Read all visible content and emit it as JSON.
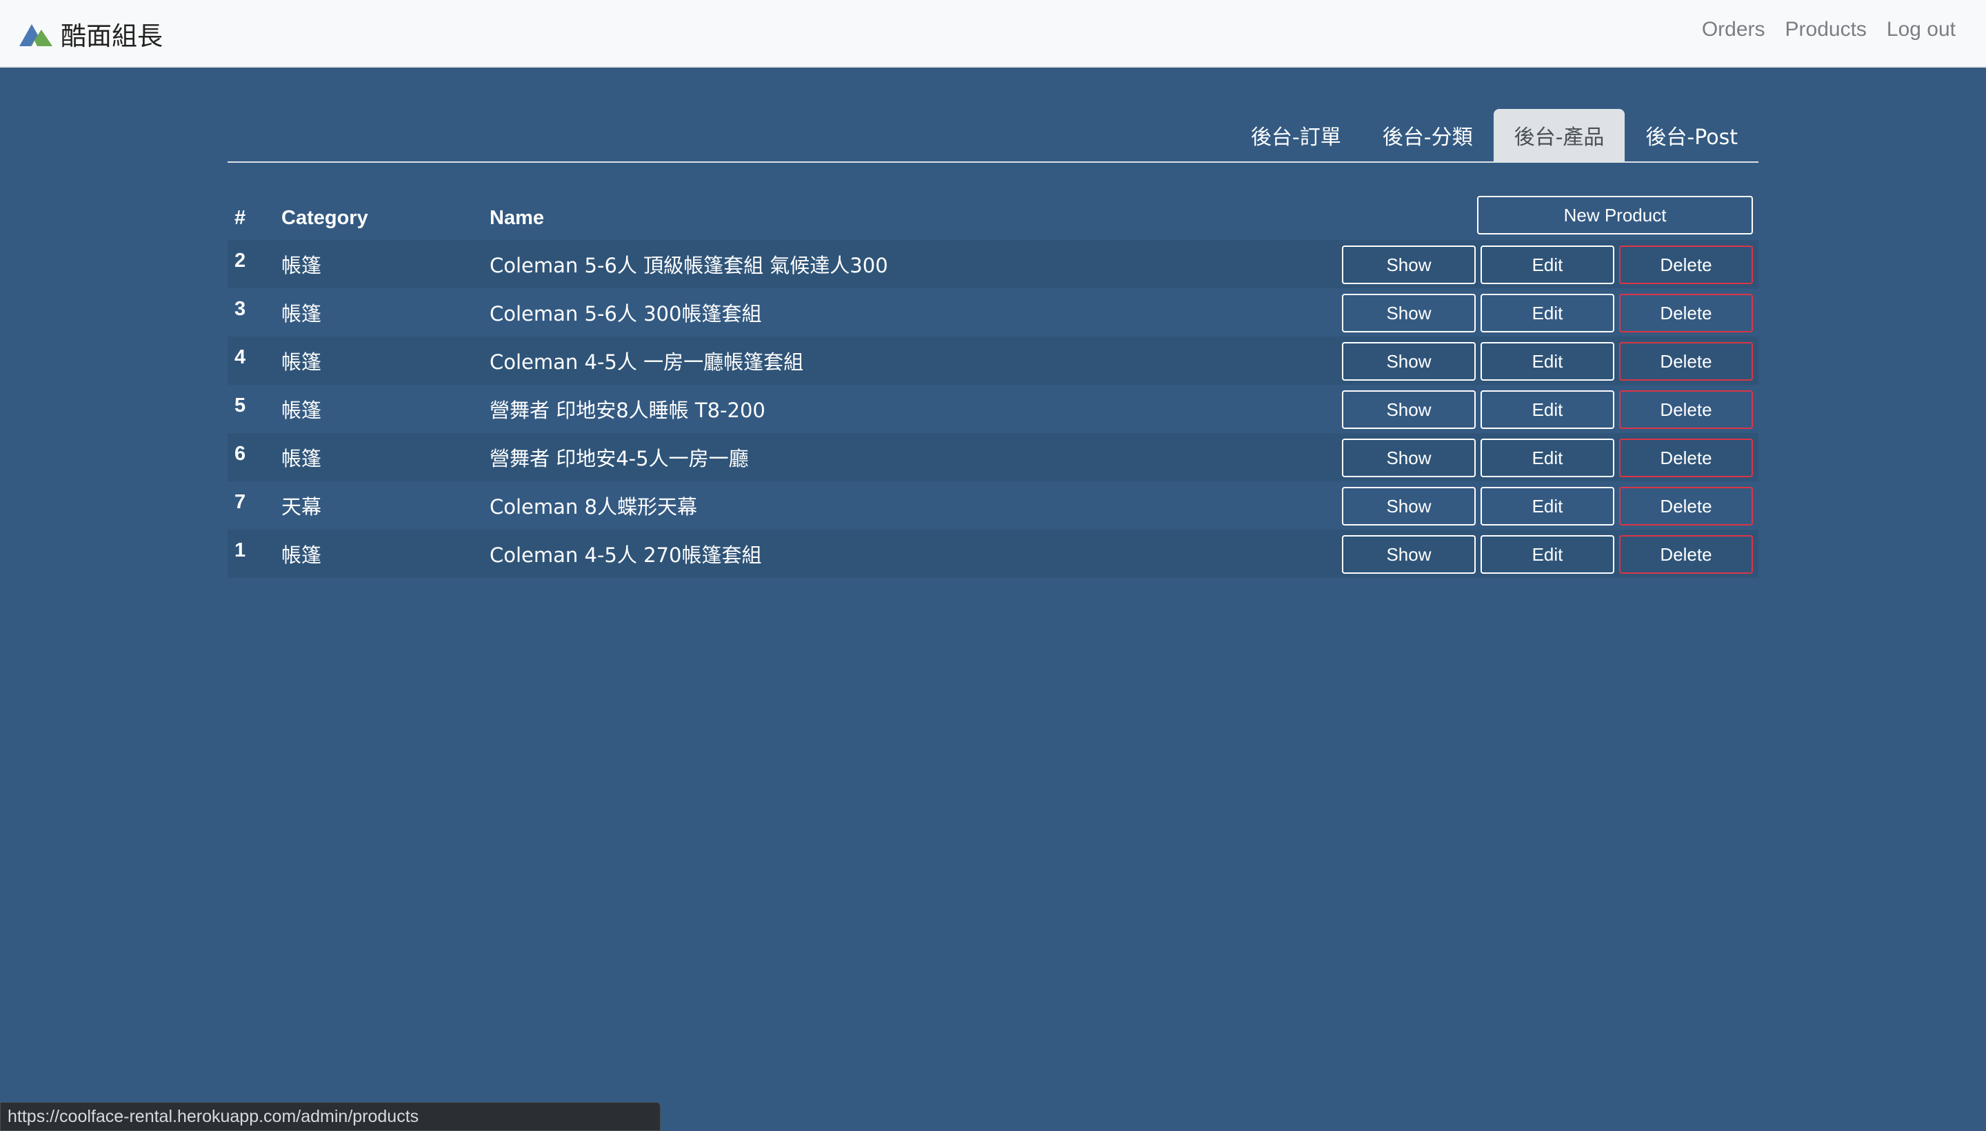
{
  "brand": {
    "name": "酷面組長"
  },
  "nav": {
    "links": [
      "Orders",
      "Products",
      "Log out"
    ]
  },
  "tabs": [
    {
      "label": "後台-訂單",
      "active": false
    },
    {
      "label": "後台-分類",
      "active": false
    },
    {
      "label": "後台-產品",
      "active": true
    },
    {
      "label": "後台-Post",
      "active": false
    }
  ],
  "table": {
    "headers": {
      "num": "#",
      "category": "Category",
      "name": "Name"
    },
    "new_button": "New Product",
    "rows": [
      {
        "id": "2",
        "category": "帳篷",
        "name": "Coleman 5-6人 頂級帳篷套組 氣候達人300"
      },
      {
        "id": "3",
        "category": "帳篷",
        "name": "Coleman 5-6人 300帳篷套組"
      },
      {
        "id": "4",
        "category": "帳篷",
        "name": "Coleman 4-5人 一房一廳帳篷套組"
      },
      {
        "id": "5",
        "category": "帳篷",
        "name": "營舞者 印地安8人睡帳 T8-200"
      },
      {
        "id": "6",
        "category": "帳篷",
        "name": "營舞者 印地安4-5人一房一廳"
      },
      {
        "id": "7",
        "category": "天幕",
        "name": "Coleman 8人蝶形天幕"
      },
      {
        "id": "1",
        "category": "帳篷",
        "name": "Coleman 4-5人 270帳篷套組"
      }
    ],
    "actions": {
      "show": "Show",
      "edit": "Edit",
      "delete": "Delete"
    }
  },
  "status_bar": {
    "url": "https://coolface-rental.herokuapp.com/admin/products"
  },
  "colors": {
    "page_bg": "#345a82",
    "row_stripe": "#2f5478",
    "navbar_bg": "#f8f9fa",
    "active_tab_bg": "#dee2e6",
    "delete_border": "#dc3545"
  }
}
